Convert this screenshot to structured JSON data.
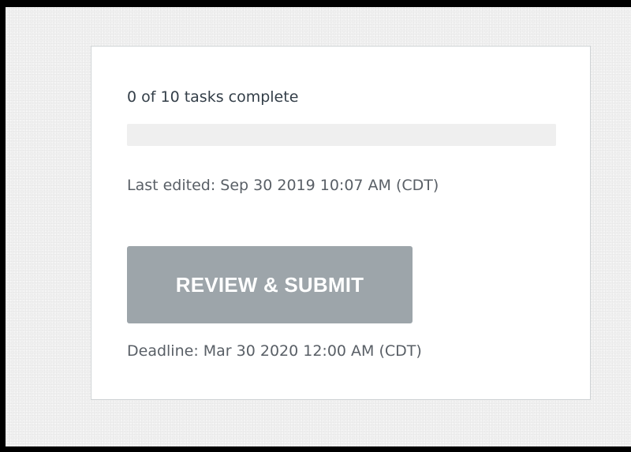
{
  "progress": {
    "status_text": "0 of 10 tasks complete",
    "completed": 0,
    "total": 10
  },
  "last_edited": "Last edited: Sep 30 2019 10:07 AM (CDT)",
  "submit_button": {
    "label": "REVIEW & SUBMIT",
    "enabled": false
  },
  "deadline": "Deadline: Mar 30 2020 12:00 AM (CDT)",
  "colors": {
    "button_disabled": "#9da5aa",
    "progress_track": "#efefef",
    "progress_fill": "#00bf6f",
    "text_dark": "#333e48",
    "text_muted": "#595f66"
  }
}
